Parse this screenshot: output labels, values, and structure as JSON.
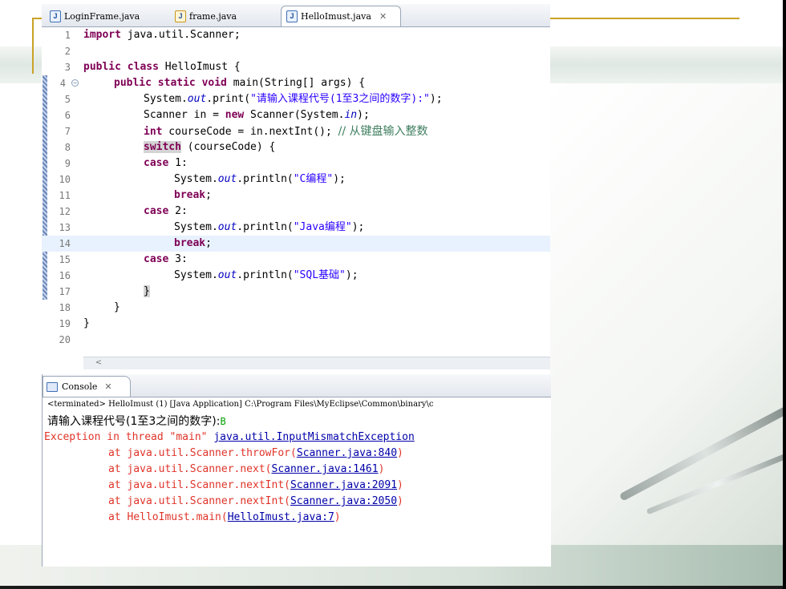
{
  "tabs": [
    {
      "label": "LoginFrame.java",
      "icon": "java-file-icon"
    },
    {
      "label": "frame.java",
      "icon": "java-file-warning-icon"
    },
    {
      "label": "HelloImust.java",
      "icon": "java-file-icon",
      "active": true,
      "close": "✕"
    }
  ],
  "editor": {
    "lines": [
      {
        "n": "1"
      },
      {
        "n": "2"
      },
      {
        "n": "3"
      },
      {
        "n": "4"
      },
      {
        "n": "5"
      },
      {
        "n": "6"
      },
      {
        "n": "7"
      },
      {
        "n": "8"
      },
      {
        "n": "9"
      },
      {
        "n": "10"
      },
      {
        "n": "11"
      },
      {
        "n": "12"
      },
      {
        "n": "13"
      },
      {
        "n": "14"
      },
      {
        "n": "15"
      },
      {
        "n": "16"
      },
      {
        "n": "17"
      },
      {
        "n": "18"
      },
      {
        "n": "19"
      },
      {
        "n": "20"
      }
    ],
    "code": {
      "l1_kw": "import",
      "l1_rest": " java.util.Scanner;",
      "l3_kw": "public class",
      "l3_rest": " HelloImust {",
      "l4_kw": "public static void",
      "l4_rest": " main(String[] args) {",
      "l5_a": "System.",
      "l5_f": "out",
      "l5_b": ".print(",
      "l5_s": "\"请输入课程代号(1至3之间的数字):\"",
      "l5_c": ");",
      "l6_a": "Scanner in = ",
      "l6_kw": "new",
      "l6_b": " Scanner(System.",
      "l6_f": "in",
      "l6_c": ");",
      "l7_kw": "int",
      "l7_rest": " courseCode = in.nextInt(); ",
      "l7_cmt": "// 从键盘输入整数",
      "l8_kw": "switch",
      "l8_rest": " (courseCode) {",
      "l9_kw": "case",
      "l9_rest": " 1:",
      "l10_a": "System.",
      "l10_f": "out",
      "l10_b": ".println(",
      "l10_s": "\"C编程\"",
      "l10_c": ");",
      "l11_kw": "break",
      "l11_rest": ";",
      "l12_kw": "case",
      "l12_rest": " 2:",
      "l13_a": "System.",
      "l13_f": "out",
      "l13_b": ".println(",
      "l13_s": "\"Java编程\"",
      "l13_c": ");",
      "l14_kw": "break",
      "l14_rest": ";",
      "l15_kw": "case",
      "l15_rest": " 3:",
      "l16_a": "System.",
      "l16_f": "out",
      "l16_b": ".println(",
      "l16_s": "\"SQL基础\"",
      "l16_c": ");",
      "l17": "}",
      "l18": "}",
      "l19": "}"
    }
  },
  "console": {
    "tab_label": "Console",
    "tab_close": "✕",
    "terminated": "<terminated> HelloImust (1) [Java Application] C:\\Program Files\\MyEclipse\\Common\\binary\\c",
    "prompt": "请输入课程代号(1至3之间的数字):",
    "input": "B",
    "exception_prefix": "Exception in thread \"main\" ",
    "exception_class": "java.util.InputMismatchException",
    "stack": [
      {
        "at": "at java.util.Scanner.throwFor(",
        "link": "Scanner.java:840",
        "end": ")"
      },
      {
        "at": "at java.util.Scanner.next(",
        "link": "Scanner.java:1461",
        "end": ")"
      },
      {
        "at": "at java.util.Scanner.nextInt(",
        "link": "Scanner.java:2091",
        "end": ")"
      },
      {
        "at": "at java.util.Scanner.nextInt(",
        "link": "Scanner.java:2050",
        "end": ")"
      },
      {
        "at": "at HelloImust.main(",
        "link": "HelloImust.java:7",
        "end": ")"
      }
    ]
  },
  "colors": {
    "keyword": "#7f0055",
    "string": "#2a00ff",
    "comment": "#3f7f5f",
    "error": "#e0342a",
    "link": "#0000aa",
    "accent_gold": "#c9a227"
  }
}
